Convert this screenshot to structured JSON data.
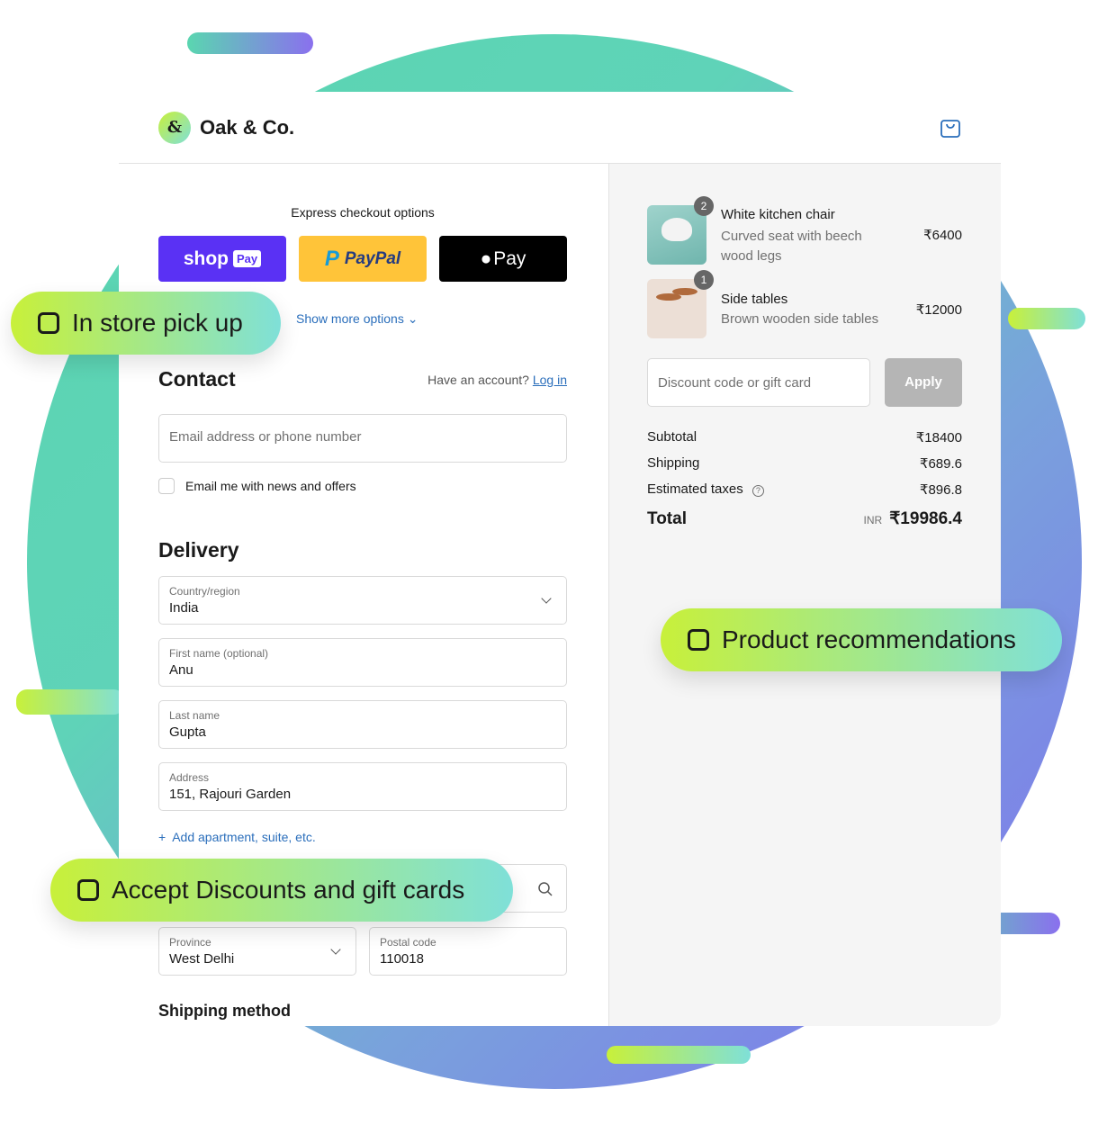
{
  "brand": {
    "name": "Oak & Co.",
    "mark": "&"
  },
  "express": {
    "title": "Express checkout options",
    "shop_pay": "shop",
    "shop_pay_badge": "Pay",
    "paypal": "PayPal",
    "apple_pay": "Pay",
    "show_more": "Show more options"
  },
  "contact": {
    "title": "Contact",
    "have_account": "Have an account?",
    "login": "Log in",
    "email_placeholder": "Email address or phone number",
    "newsletter": "Email me with news and offers",
    "newsletter_checked": false
  },
  "delivery": {
    "title": "Delivery",
    "country_label": "Country/region",
    "country": "India",
    "first_label": "First name (optional)",
    "first": "Anu",
    "last_label": "Last name",
    "last": "Gupta",
    "address_label": "Address",
    "address": "151, Rajouri Garden",
    "add_apartment": "Add apartment, suite, etc.",
    "province_label": "Province",
    "province": "West Delhi",
    "postal_label": "Postal code",
    "postal": "110018",
    "shipping_method": "Shipping method"
  },
  "cart": {
    "items": [
      {
        "qty": "2",
        "name": "White kitchen chair",
        "desc1": "Curved seat with beech",
        "desc2": "wood legs",
        "price": "₹6400"
      },
      {
        "qty": "1",
        "name": "Side tables",
        "desc1": "Brown wooden side tables",
        "price": "₹12000"
      }
    ],
    "discount_placeholder": "Discount code or gift card",
    "apply": "Apply",
    "subtotal_label": "Subtotal",
    "subtotal": "₹18400",
    "shipping_label": "Shipping",
    "shipping": "₹689.6",
    "taxes_label": "Estimated taxes",
    "taxes": "₹896.8",
    "total_label": "Total",
    "currency": "INR",
    "total": "₹19986.4"
  },
  "features": {
    "pickup": "In store pick up",
    "recommendations": "Product recommendations",
    "discounts": "Accept Discounts and gift cards"
  },
  "colors": {
    "shop_pay": "#5a31f4",
    "paypal": "#ffc439",
    "apple_pay": "#000000",
    "link": "#2a6ebb",
    "accent_gradient_start": "#c8f03a",
    "accent_gradient_end": "#7fe0d8"
  }
}
